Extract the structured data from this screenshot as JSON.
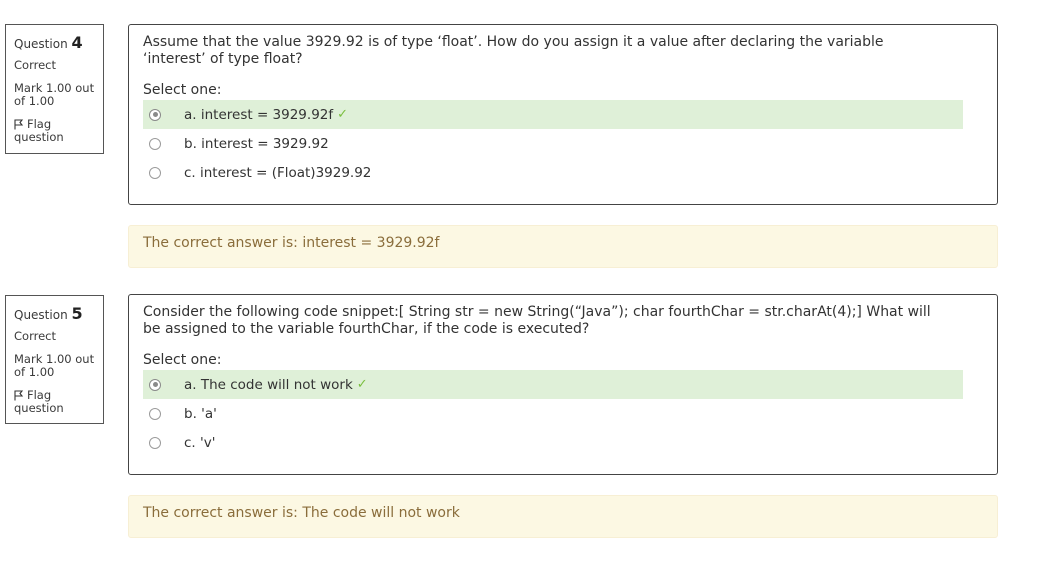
{
  "questions": [
    {
      "label": "Question",
      "number": "4",
      "state": "Correct",
      "grade": "Mark 1.00 out of 1.00",
      "flag": "Flag question",
      "text": "Assume that the value 3929.92 is of type ‘float’. How do you assign it a value after declaring the variable ‘interest’ of type float?",
      "prompt": "Select one:",
      "answers": [
        {
          "label": "a. interest = 3929.92f",
          "selected": true,
          "correct": true
        },
        {
          "label": "b. interest = 3929.92",
          "selected": false,
          "correct": false
        },
        {
          "label": "c. interest = (Float)3929.92",
          "selected": false,
          "correct": false
        }
      ],
      "feedback": "The correct answer is: interest = 3929.92f"
    },
    {
      "label": "Question",
      "number": "5",
      "state": "Correct",
      "grade": "Mark 1.00 out of 1.00",
      "flag": "Flag question",
      "text": "Consider the following code snippet:[ String str = new String(“Java”); char fourthChar = str.charAt(4);] What will be assigned to the variable fourthChar, if the code is executed?",
      "prompt": "Select one:",
      "answers": [
        {
          "label": "a. The code will not work",
          "selected": true,
          "correct": true
        },
        {
          "label": "b. 'a'",
          "selected": false,
          "correct": false
        },
        {
          "label": "c. 'v'",
          "selected": false,
          "correct": false
        }
      ],
      "feedback": "The correct answer is: The code will not work"
    }
  ],
  "colors": {
    "correct_bg": "#dff0d8",
    "feedback_bg": "#fcf8e3",
    "feedback_text": "#8a6d3b",
    "tick": "#7bbf3f"
  },
  "icons": {
    "flag": "flag-icon",
    "tick": "check-icon"
  }
}
